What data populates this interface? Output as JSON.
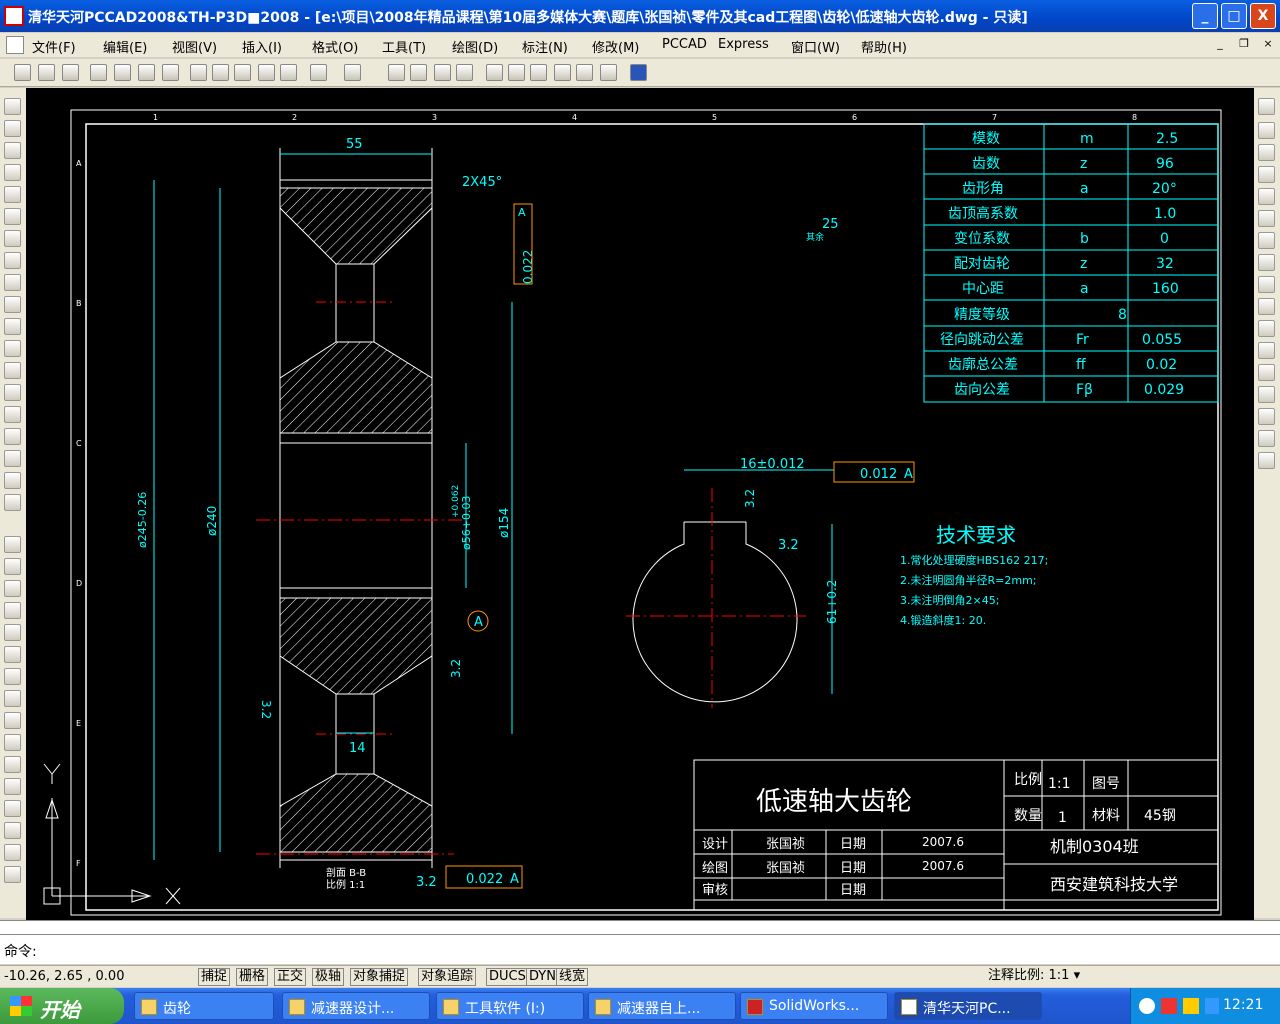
{
  "window": {
    "title": "清华天河PCCAD2008&TH-P3D■2008 - [e:\\项目\\2008年精品课程\\第10届多媒体大赛\\题库\\张国祯\\零件及其cad工程图\\齿轮\\低速轴大齿轮.dwg - 只读]",
    "min_label": "_",
    "max_label": "□",
    "close_label": "X"
  },
  "menu": [
    "文件(F)",
    "编辑(E)",
    "视图(V)",
    "插入(I)",
    "格式(O)",
    "工具(T)",
    "绘图(D)",
    "标注(N)",
    "修改(M)",
    "PCCAD",
    "Express",
    "窗口(W)",
    "帮助(H)"
  ],
  "doc_buttons": {
    "min": "_",
    "restore": "❐",
    "close": "×"
  },
  "drawing": {
    "border_cols": [
      "1",
      "2",
      "3",
      "4",
      "5",
      "6",
      "7",
      "8"
    ],
    "border_rows": [
      "A",
      "B",
      "C",
      "D",
      "E",
      "F"
    ],
    "param_table": [
      [
        "模数",
        "m",
        "2.5"
      ],
      [
        "齿数",
        "z",
        "96"
      ],
      [
        "齿形角",
        "a",
        "20°"
      ],
      [
        "齿顶高系数",
        "",
        "1.0"
      ],
      [
        "变位系数",
        "b",
        "0"
      ],
      [
        "配对齿轮",
        "z",
        "32"
      ],
      [
        "中心距",
        "a",
        "160"
      ],
      [
        "精度等级",
        "",
        "8"
      ],
      [
        "径向跳动公差",
        "Fr",
        "0.055"
      ],
      [
        "齿廓总公差",
        "ff",
        "0.02"
      ],
      [
        "齿向公差",
        "Fβ",
        "0.029"
      ]
    ],
    "dims": {
      "width55": "55",
      "chamfer": "2X45°",
      "tol022a": "0.022",
      "datumA": "A",
      "d245": "ø245-0.26",
      "d240": "ø240",
      "d56": "ø56+0.03",
      "d56b": "+0.062",
      "d154": "ø154",
      "w14": "14",
      "keyw": "16±0.012",
      "sym012": "0.012",
      "rough32": "3.2",
      "rough25": "25",
      "keyh": "61+0.2",
      "section": "剖面 B-B",
      "scale_note": "比例 1:1",
      "runout": "0.022",
      "s": "其余"
    },
    "tech_title": "技术要求",
    "tech_items": [
      "1.常化处理硬度HBS162 217;",
      "2.未注明圆角半径R=2mm;",
      "3.未注明倒角2×45;",
      "4.锻造斜度1: 20."
    ],
    "title_block": {
      "name": "低速轴大齿轮",
      "scale_label": "比例",
      "scale": "1:1",
      "drawing_no_label": "图号",
      "qty_label": "数量",
      "qty": "1",
      "material_label": "材料",
      "material": "45钢",
      "design_label": "设计",
      "drafter_label": "绘图",
      "review_label": "审核",
      "person": "张国祯",
      "person2": "张国祯",
      "date_label": "日期",
      "date1": "2007.6",
      "date2": "2007.6",
      "class": "机制0304班",
      "school": "西安建筑科技大学"
    }
  },
  "command": {
    "prompt": "命令:"
  },
  "status": {
    "coords": "-10.26, 2.65  , 0.00",
    "buttons": [
      "捕捉",
      "栅格",
      "正交",
      "极轴",
      "对象捕捉",
      "对象追踪",
      "DUCS",
      "DYN",
      "线宽"
    ],
    "annotation_scale": "注释比例: 1:1 ▾"
  },
  "taskbar": {
    "start": "开始",
    "tasks": [
      "齿轮",
      "减速器设计...",
      "工具软件 (I:)",
      "减速器自上...",
      "SolidWorks...",
      "清华天河PC..."
    ],
    "clock": "12:21"
  }
}
